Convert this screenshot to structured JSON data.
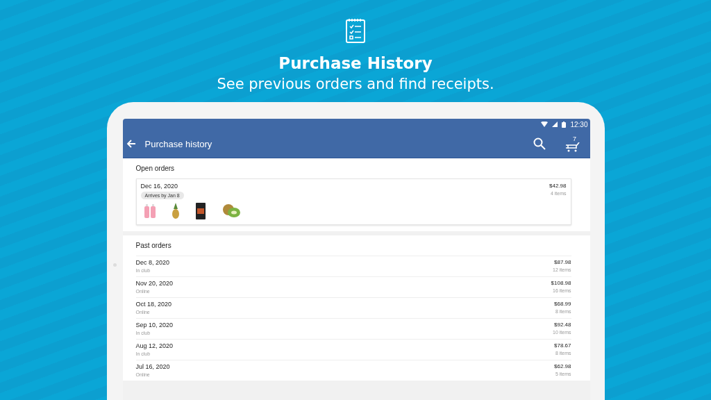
{
  "promo": {
    "title": "Purchase History",
    "subtitle": "See previous orders and find receipts."
  },
  "status_bar": {
    "time": "12:30"
  },
  "app_bar": {
    "title": "Purchase history",
    "cart_count": "7"
  },
  "open_orders": {
    "heading": "Open orders",
    "orders": [
      {
        "date": "Dec 16, 2020",
        "badge": "Arrives by Jan 8",
        "total": "$42.98",
        "count": "4 items"
      }
    ]
  },
  "past_orders": {
    "heading": "Past orders",
    "orders": [
      {
        "date": "Dec 8, 2020",
        "channel": "In club",
        "total": "$87.98",
        "count": "12 items"
      },
      {
        "date": "Nov 20, 2020",
        "channel": "Online",
        "total": "$108.98",
        "count": "16 items"
      },
      {
        "date": "Oct 18, 2020",
        "channel": "Online",
        "total": "$68.99",
        "count": "8 items"
      },
      {
        "date": "Sep 10, 2020",
        "channel": "In club",
        "total": "$92.48",
        "count": "10 items"
      },
      {
        "date": "Aug 12, 2020",
        "channel": "In club",
        "total": "$78.67",
        "count": "8 items"
      },
      {
        "date": "Jul 16, 2020",
        "channel": "Online",
        "total": "$62.98",
        "count": "5 items"
      }
    ]
  }
}
